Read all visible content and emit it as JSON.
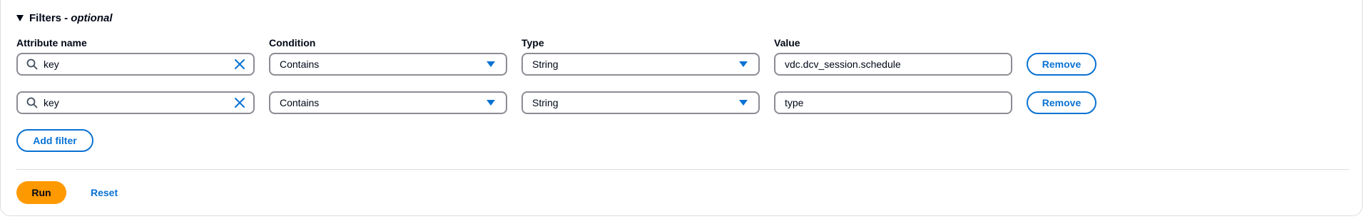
{
  "filters": {
    "title": "Filters -",
    "title_suffix": "optional",
    "columns": {
      "attribute_name": "Attribute name",
      "condition": "Condition",
      "type": "Type",
      "value": "Value"
    },
    "rows": [
      {
        "attribute": "key",
        "condition": "Contains",
        "type": "String",
        "value": "vdc.dcv_session.schedule",
        "remove_label": "Remove"
      },
      {
        "attribute": "key",
        "condition": "Contains",
        "type": "String",
        "value": "type",
        "remove_label": "Remove"
      }
    ],
    "add_filter_label": "Add filter"
  },
  "actions": {
    "run_label": "Run",
    "reset_label": "Reset"
  },
  "colors": {
    "accent": "#0972d3",
    "primary_button": "#ff9900",
    "border": "#8c8c94"
  },
  "icons": [
    "search-icon",
    "clear-icon",
    "chevron-down-icon",
    "caret-down-icon"
  ]
}
